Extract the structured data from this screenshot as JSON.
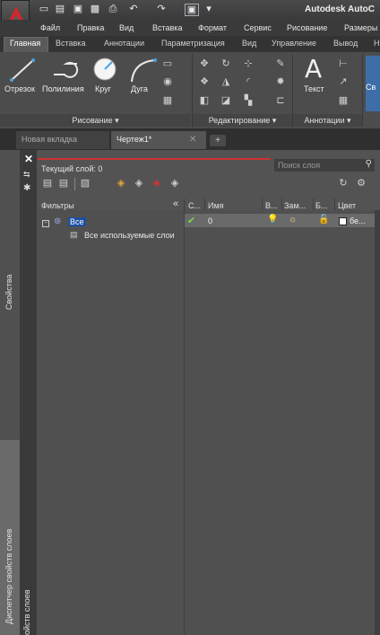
{
  "title_bar": {
    "title": "Autodesk AutoC",
    "qat_icons": [
      "new-icon",
      "open-icon",
      "save-icon",
      "saveas-icon",
      "print-icon",
      "undo-icon",
      "redo-icon",
      "workspace-icon"
    ]
  },
  "menu_bar": [
    "Файл",
    "Правка",
    "Вид",
    "Вставка",
    "Формат",
    "Сервис",
    "Рисование",
    "Размеры"
  ],
  "ribbon_tabs": [
    "Главная",
    "Вставка",
    "Аннотации",
    "Параметризация",
    "Вид",
    "Управление",
    "Вывод",
    "Н"
  ],
  "ribbon": {
    "draw": {
      "title": "Рисование ▾",
      "tools": [
        "Отрезок",
        "Полилиния",
        "Круг",
        "Дуга"
      ]
    },
    "modify": {
      "title": "Редактирование ▾"
    },
    "annotation": {
      "title": "Аннотации ▾",
      "text_label": "Текст"
    },
    "partial_label": "Св"
  },
  "doc_tabs": {
    "tab1": "Новая вкладка",
    "tab2": "Чертеж1*",
    "add": "+"
  },
  "layer_manager": {
    "current_layer": "Текущий слой: 0",
    "search_placeholder": "Поиск слоя",
    "filters_header": "Фильтры",
    "collapse": "«",
    "filter_all": "Все",
    "filter_used": "Все используемые слои",
    "columns": [
      "С...",
      "Имя",
      "В...",
      "Зам...",
      "Б...",
      "Цвет"
    ],
    "rows": [
      {
        "name": "0",
        "color": "бе..."
      }
    ],
    "side_label": "Свойства",
    "palette_title": "Диспетчер свойств слоев",
    "palette_title2": "ойств слоев"
  },
  "colors": {
    "accent": "#d3262a",
    "ribbon_bg": "#4c4c4c",
    "panel_bg": "#535353"
  }
}
